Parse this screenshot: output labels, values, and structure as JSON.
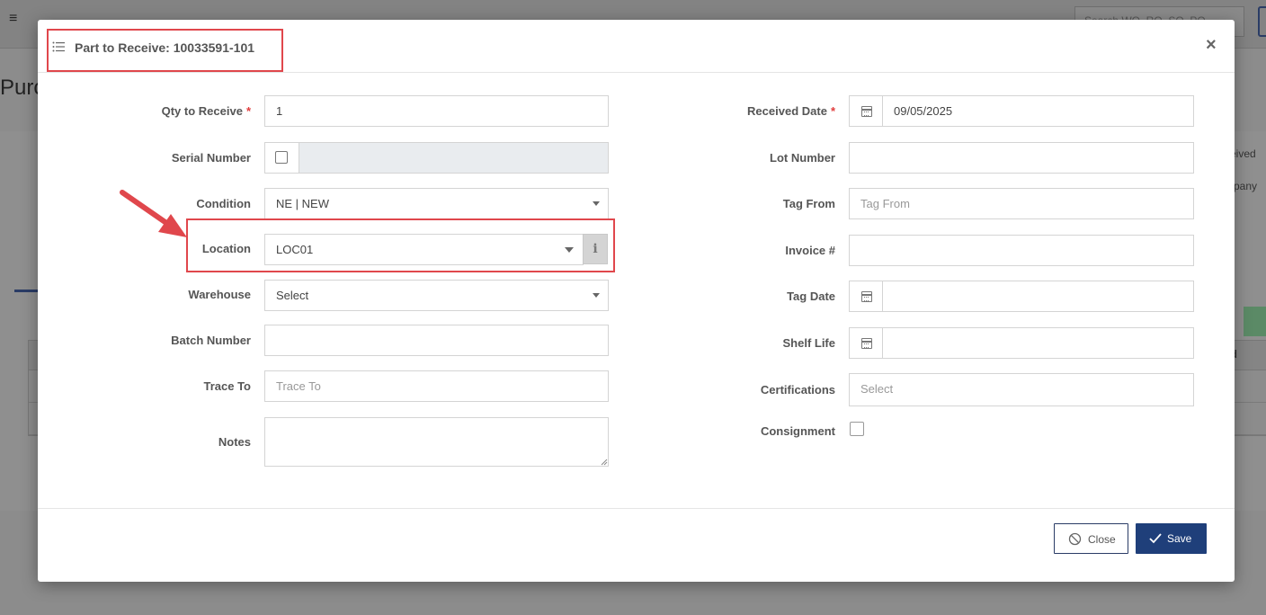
{
  "background": {
    "search_placeholder": "Search WO, RO, SO, PO",
    "page_title": "Purc",
    "right_text_1": "eived",
    "right_text_2": "pany",
    "col_header": "ed"
  },
  "modal": {
    "title": "Part to Receive: 10033591-101",
    "close_symbol": "×",
    "left_fields": {
      "qty_label": "Qty to Receive",
      "qty_value": "1",
      "serial_label": "Serial Number",
      "condition_label": "Condition",
      "condition_value": "NE | NEW",
      "location_label": "Location",
      "location_value": "LOC01",
      "warehouse_label": "Warehouse",
      "warehouse_value": "Select",
      "batch_label": "Batch Number",
      "trace_to_label": "Trace To",
      "trace_to_placeholder": "Trace To",
      "notes_label": "Notes"
    },
    "right_fields": {
      "received_date_label": "Received Date",
      "received_date_value": "09/05/2025",
      "lot_label": "Lot Number",
      "tag_from_label": "Tag From",
      "tag_from_placeholder": "Tag From",
      "invoice_label": "Invoice #",
      "tag_date_label": "Tag Date",
      "shelf_life_label": "Shelf Life",
      "certifications_label": "Certifications",
      "certifications_placeholder": "Select",
      "consignment_label": "Consignment"
    },
    "required_marker": "*",
    "info_icon_glyph": "i",
    "buttons": {
      "close_label": "Close",
      "save_label": "Save"
    }
  },
  "colors": {
    "highlight": "#e0474c",
    "primary": "#1f3f7a",
    "required": "#e03c3c"
  }
}
